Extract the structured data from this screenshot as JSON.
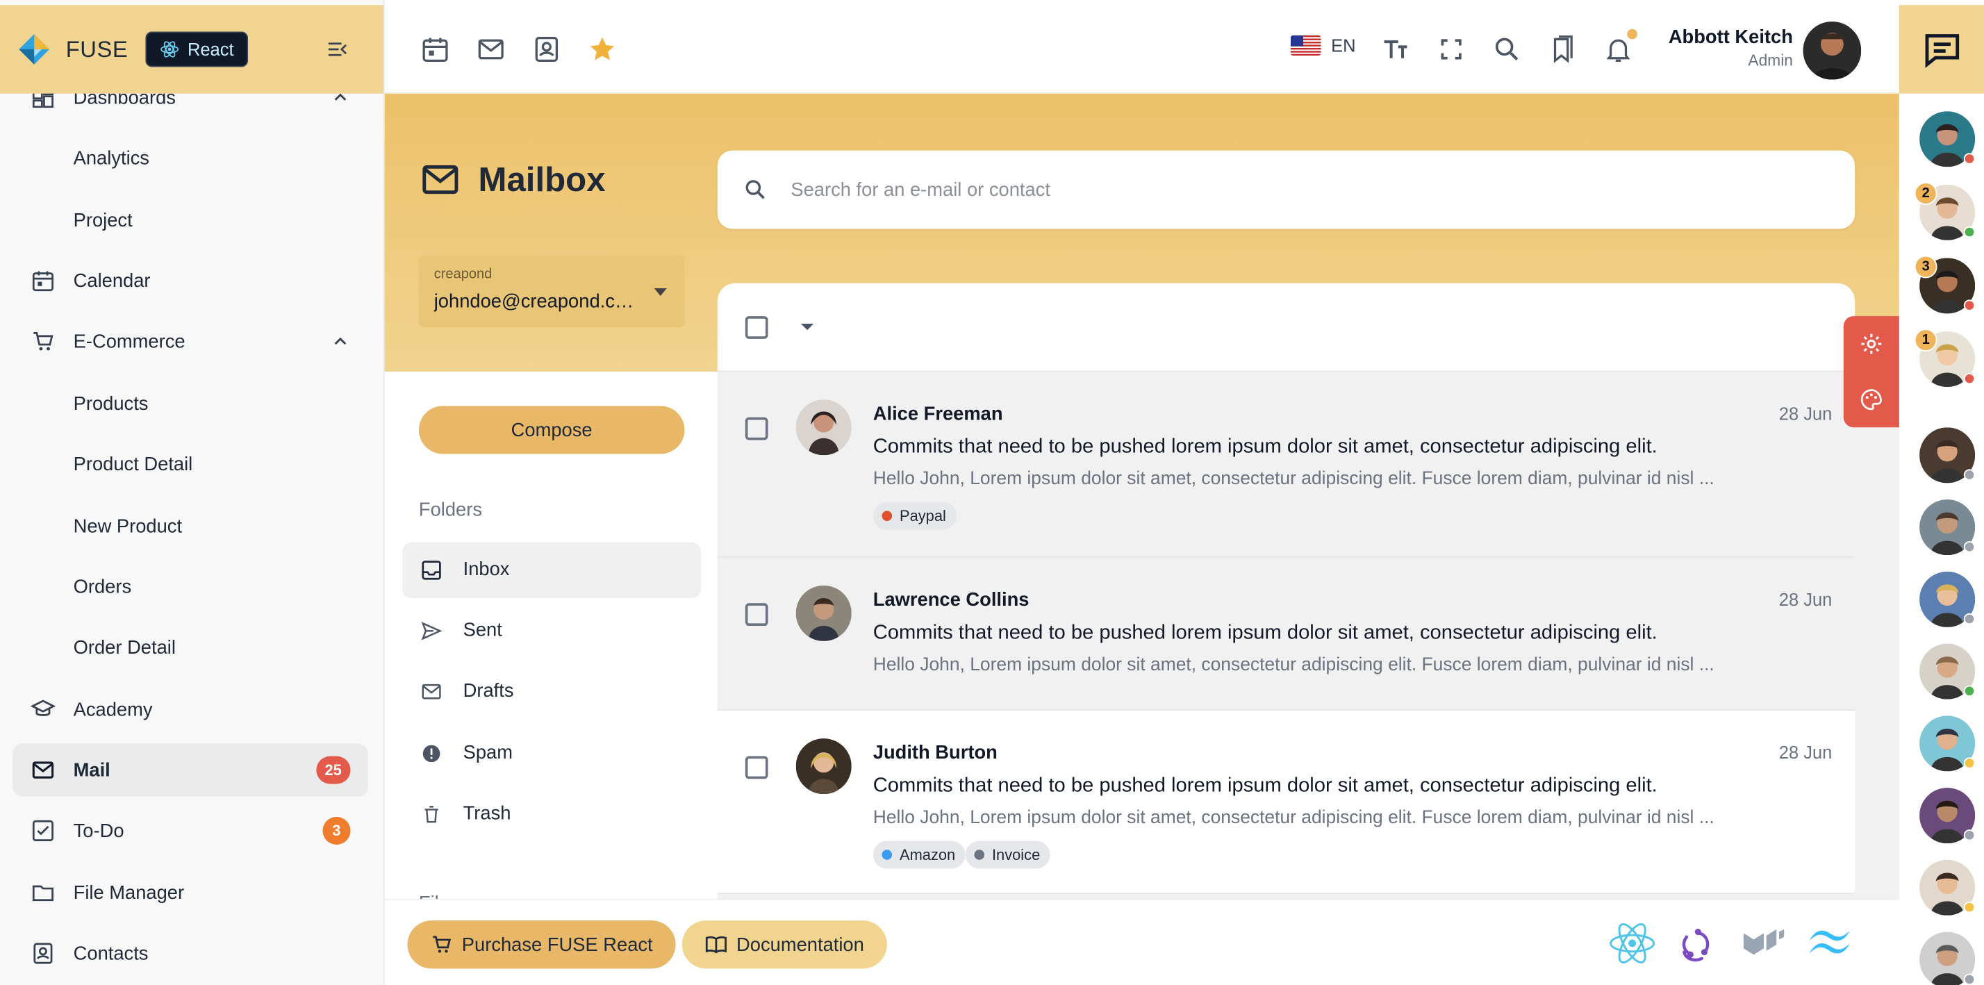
{
  "brand": {
    "logo_text": "FUSE",
    "badge_label": "React"
  },
  "sidebar": {
    "items": [
      {
        "label": "Dashboards",
        "icon": "dashboards-icon"
      },
      {
        "label": "Analytics"
      },
      {
        "label": "Project"
      },
      {
        "label": "Calendar",
        "icon": "calendar-icon"
      },
      {
        "label": "E-Commerce",
        "icon": "cart-icon"
      },
      {
        "label": "Products"
      },
      {
        "label": "Product Detail"
      },
      {
        "label": "New Product"
      },
      {
        "label": "Orders"
      },
      {
        "label": "Order Detail"
      },
      {
        "label": "Academy",
        "icon": "academy-icon"
      },
      {
        "label": "Mail",
        "icon": "mail-icon",
        "badge": "25",
        "badge_color": "#e45a4a"
      },
      {
        "label": "To-Do",
        "icon": "todo-icon",
        "badge": "3",
        "badge_color": "#ef7d2c"
      },
      {
        "label": "File Manager",
        "icon": "folder-icon"
      },
      {
        "label": "Contacts",
        "icon": "contacts-icon"
      }
    ]
  },
  "topbar": {
    "language": "EN",
    "user_name": "Abbott Keitch",
    "user_role": "Admin"
  },
  "mailbox": {
    "title": "Mailbox",
    "account_label": "creapond",
    "account_value": "johndoe@creapond.com",
    "search_placeholder": "Search for an e-mail or contact",
    "compose_label": "Compose",
    "folders_title": "Folders",
    "folders": [
      {
        "label": "Inbox",
        "icon": "inbox-icon"
      },
      {
        "label": "Sent",
        "icon": "send-icon"
      },
      {
        "label": "Drafts",
        "icon": "drafts-icon"
      },
      {
        "label": "Spam",
        "icon": "spam-icon"
      },
      {
        "label": "Trash",
        "icon": "trash-icon"
      }
    ],
    "filters_peek": "Fil",
    "mails": [
      {
        "from": "Alice Freeman",
        "date": "28 Jun",
        "subject": "Commits that need to be pushed lorem ipsum dolor sit amet, consectetur adipiscing elit.",
        "snippet": "Hello John, Lorem ipsum dolor sit amet, consectetur adipiscing elit. Fusce lorem diam, pulvinar id nisl ...",
        "labels": [
          {
            "name": "Paypal",
            "color": "#e0502e"
          }
        ]
      },
      {
        "from": "Lawrence Collins",
        "date": "28 Jun",
        "subject": "Commits that need to be pushed lorem ipsum dolor sit amet, consectetur adipiscing elit.",
        "snippet": "Hello John, Lorem ipsum dolor sit amet, consectetur adipiscing elit. Fusce lorem diam, pulvinar id nisl ...",
        "labels": []
      },
      {
        "from": "Judith Burton",
        "date": "28 Jun",
        "subject": "Commits that need to be pushed lorem ipsum dolor sit amet, consectetur adipiscing elit.",
        "snippet": "Hello John, Lorem ipsum dolor sit amet, consectetur adipiscing elit. Fusce lorem diam, pulvinar id nisl ...",
        "labels": [
          {
            "name": "Amazon",
            "color": "#3b9bf0"
          },
          {
            "name": "Invoice",
            "color": "#6b7280"
          }
        ]
      }
    ]
  },
  "footer": {
    "purchase_label": "Purchase FUSE React",
    "docs_label": "Documentation"
  },
  "chat": {
    "contacts": [
      {
        "status": "#e45a4a",
        "unread": ""
      },
      {
        "status": "#4caf50",
        "unread": "2"
      },
      {
        "status": "#e45a4a",
        "unread": "3"
      },
      {
        "status": "#e45a4a",
        "unread": "1"
      },
      {
        "status": "#9ca3af",
        "unread": ""
      },
      {
        "status": "#9ca3af",
        "unread": ""
      },
      {
        "status": "#9ca3af",
        "unread": ""
      },
      {
        "status": "#4caf50",
        "unread": ""
      },
      {
        "status": "#f5c242",
        "unread": ""
      },
      {
        "status": "#9ca3af",
        "unread": ""
      },
      {
        "status": "#f5c242",
        "unread": ""
      },
      {
        "status": "#9ca3af",
        "unread": ""
      }
    ]
  },
  "colors": {
    "accent": "#f0d48f",
    "hero": "#edc06a",
    "danger": "#e45a4a"
  }
}
